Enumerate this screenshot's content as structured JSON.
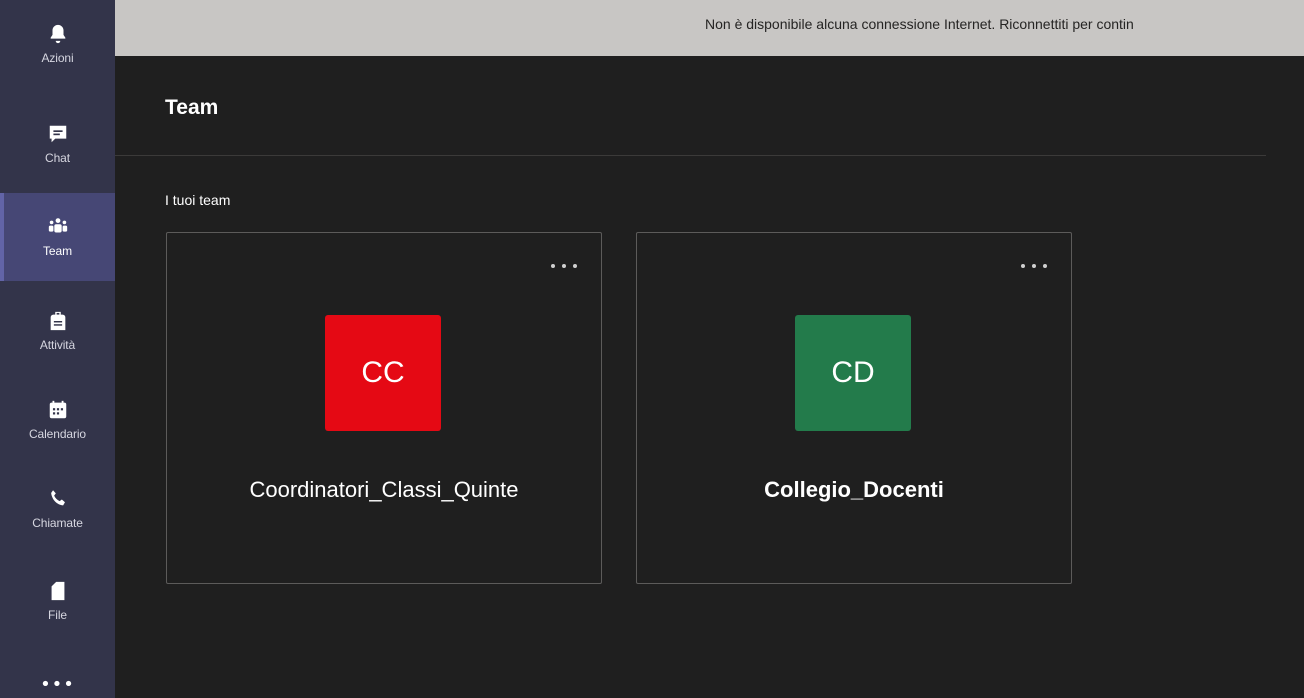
{
  "rail": {
    "items": [
      {
        "label": "Azioni",
        "icon": "bell-icon"
      },
      {
        "label": "Chat",
        "icon": "chat-icon"
      },
      {
        "label": "Team",
        "icon": "teams-icon",
        "active": true
      },
      {
        "label": "Attività",
        "icon": "backpack-icon"
      },
      {
        "label": "Calendario",
        "icon": "calendar-icon"
      },
      {
        "label": "Chiamate",
        "icon": "phone-icon"
      },
      {
        "label": "File",
        "icon": "file-icon"
      }
    ],
    "more_label": "•••"
  },
  "banner": {
    "text": "Non è disponibile alcuna connessione Internet. Riconnettiti per contin"
  },
  "header": {
    "title": "Team"
  },
  "main": {
    "section_title": "I tuoi team",
    "teams": [
      {
        "initials": "CC",
        "name": "Coordinatori_Classi_Quinte",
        "color": "#e50914",
        "bold": false
      },
      {
        "initials": "CD",
        "name": "Collegio_Docenti",
        "color": "#237b4b",
        "bold": true
      }
    ]
  },
  "colors": {
    "rail_bg": "#33344a",
    "rail_active": "#464775",
    "accent": "#6264a7",
    "app_bg": "#1f1f1f",
    "banner_bg": "#c8c6c4"
  }
}
